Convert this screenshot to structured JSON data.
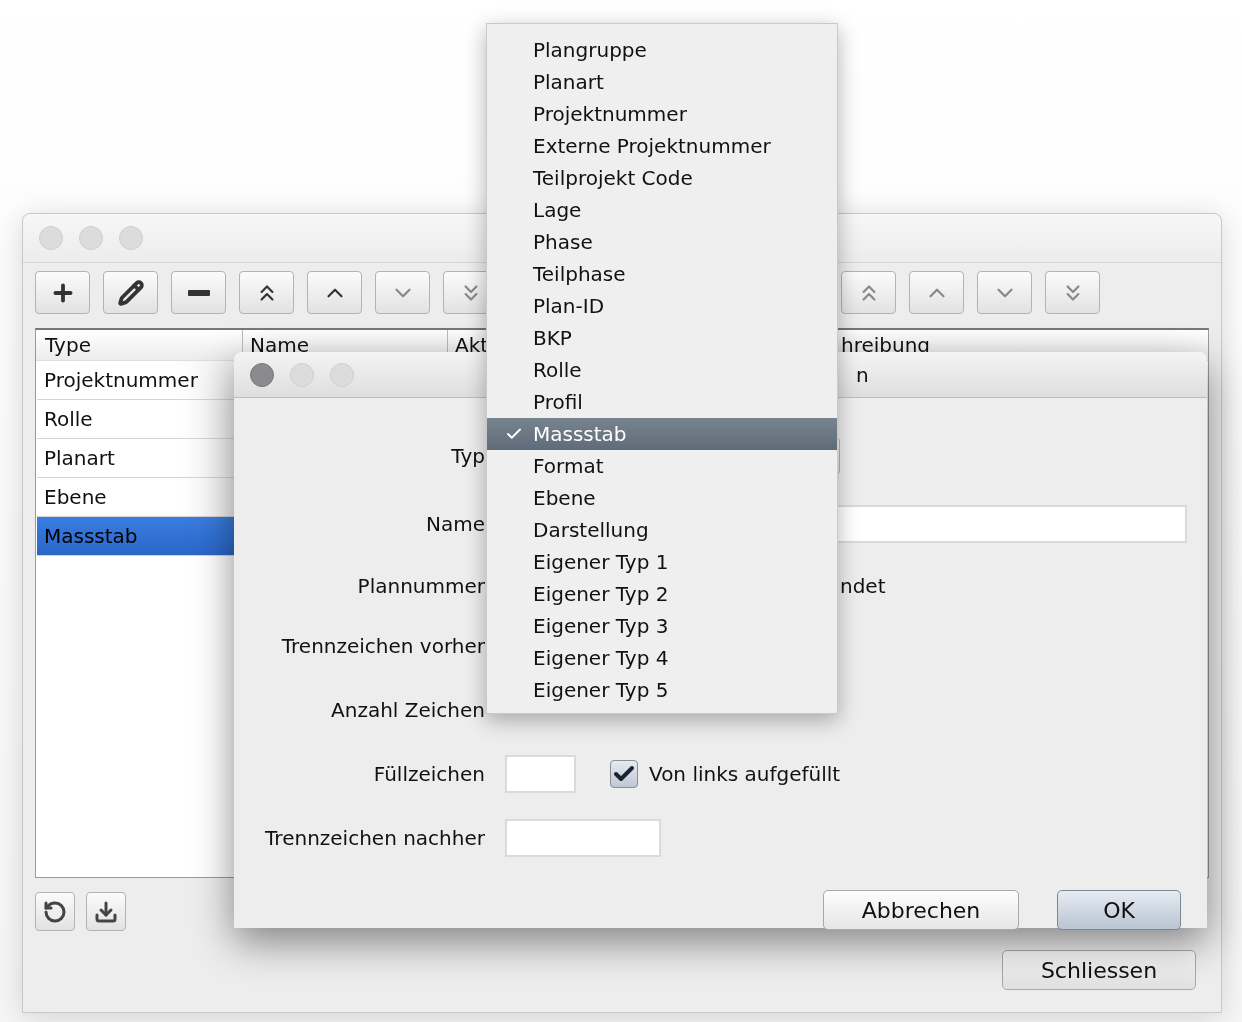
{
  "main_window": {
    "table": {
      "columns": [
        "Type",
        "Name",
        "Akt",
        "hreibung"
      ],
      "rows": [
        {
          "type": "Projektnummer",
          "selected": false
        },
        {
          "type": "Rolle",
          "selected": false
        },
        {
          "type": "Planart",
          "selected": false
        },
        {
          "type": "Ebene",
          "selected": false
        },
        {
          "type": "Massstab",
          "selected": true
        }
      ]
    },
    "buttons": [
      "Schliessen"
    ]
  },
  "dialog": {
    "title": "n",
    "fields": [
      {
        "label": "Typ",
        "kind": "combo"
      },
      {
        "label": "Name",
        "kind": "text"
      },
      {
        "label": "Plannummer",
        "kind": "note",
        "text": "ndet"
      },
      {
        "label": "Trennzeichen vorher",
        "kind": "covered"
      },
      {
        "label": "Anzahl Zeichen",
        "kind": "covered"
      },
      {
        "label": "Füllzeichen",
        "kind": "fill",
        "checkbox": {
          "label": "Von links aufgefüllt",
          "checked": true
        }
      },
      {
        "label": "Trennzeichen nachher",
        "kind": "short"
      }
    ],
    "buttons": [
      {
        "label": "Abbrechen",
        "default": false
      },
      {
        "label": "OK",
        "default": true
      }
    ]
  },
  "menu": {
    "items": [
      {
        "label": "Plangruppe",
        "selected": false
      },
      {
        "label": "Planart",
        "selected": false
      },
      {
        "label": "Projektnummer",
        "selected": false
      },
      {
        "label": "Externe Projektnummer",
        "selected": false
      },
      {
        "label": "Teilprojekt Code",
        "selected": false
      },
      {
        "label": "Lage",
        "selected": false
      },
      {
        "label": "Phase",
        "selected": false
      },
      {
        "label": "Teilphase",
        "selected": false
      },
      {
        "label": "Plan-ID",
        "selected": false
      },
      {
        "label": "BKP",
        "selected": false
      },
      {
        "label": "Rolle",
        "selected": false
      },
      {
        "label": "Profil",
        "selected": false
      },
      {
        "label": "Massstab",
        "selected": true
      },
      {
        "label": "Format",
        "selected": false
      },
      {
        "label": "Ebene",
        "selected": false
      },
      {
        "label": "Darstellung",
        "selected": false
      },
      {
        "label": "Eigener Typ 1",
        "selected": false
      },
      {
        "label": "Eigener Typ 2",
        "selected": false
      },
      {
        "label": "Eigener Typ 3",
        "selected": false
      },
      {
        "label": "Eigener Typ 4",
        "selected": false
      },
      {
        "label": "Eigener Typ 5",
        "selected": false
      }
    ]
  }
}
